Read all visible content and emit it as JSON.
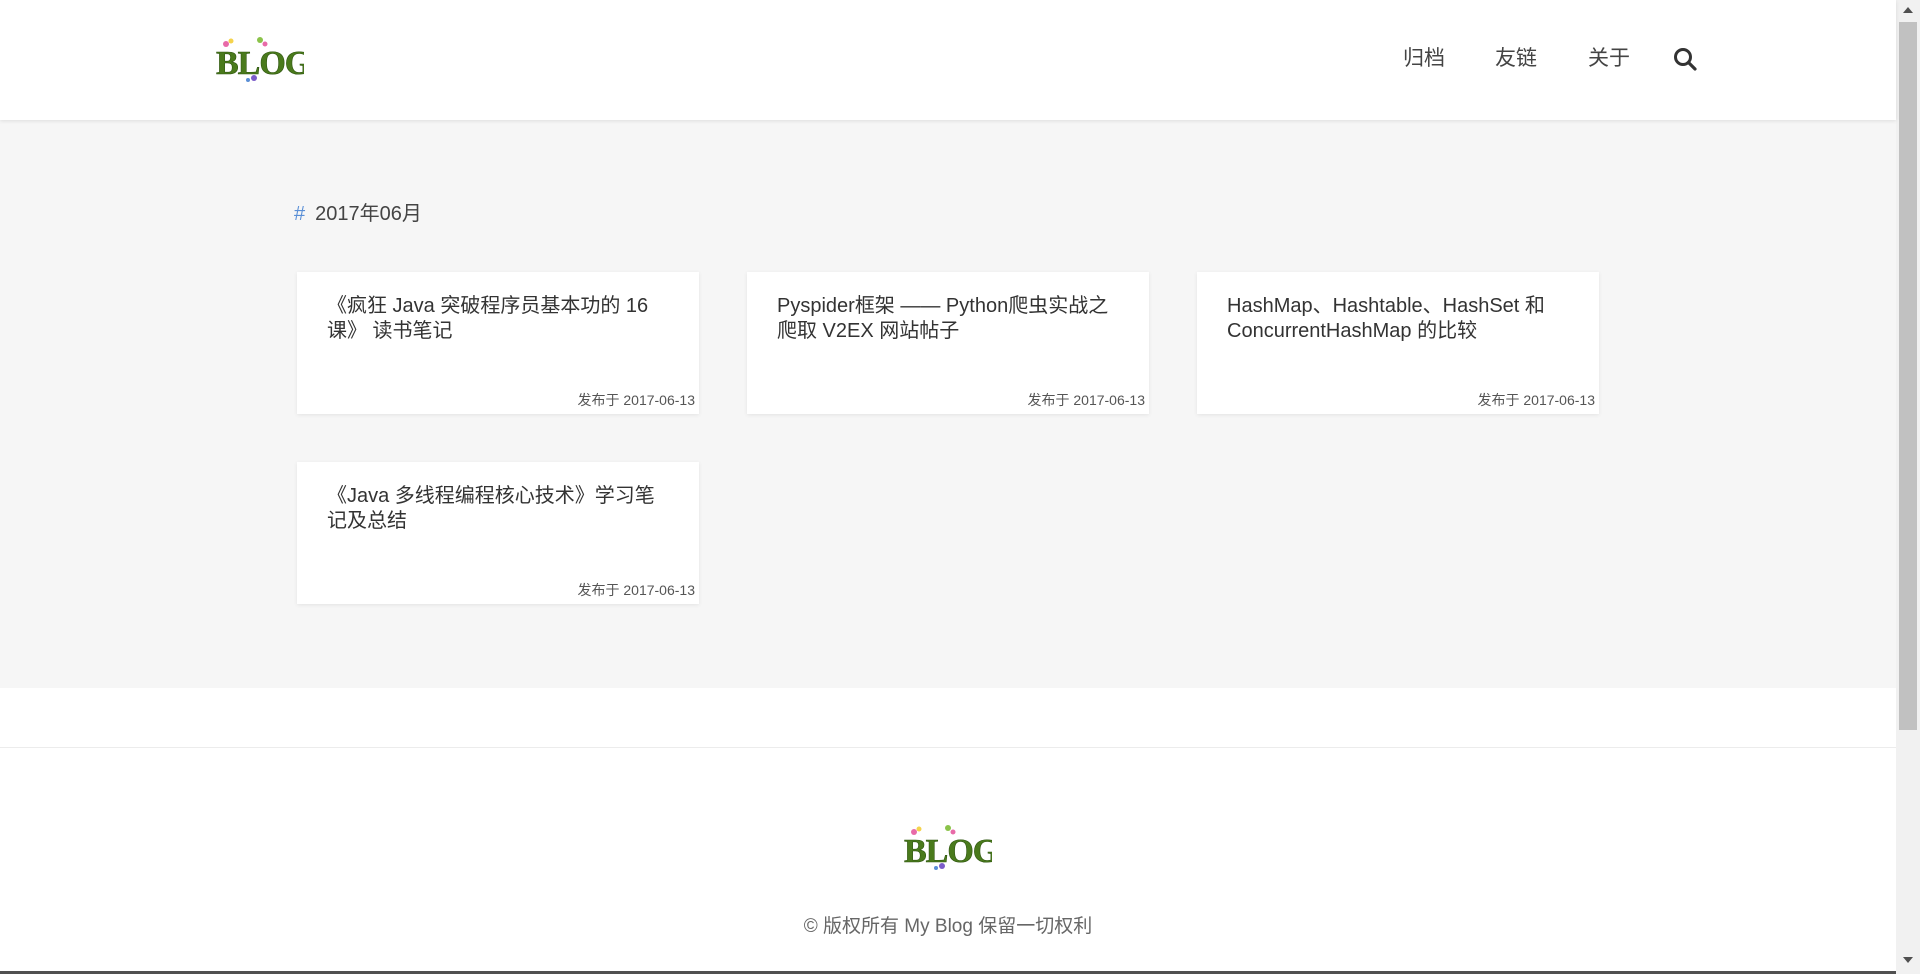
{
  "header": {
    "logo_text": "BLOG",
    "nav": [
      {
        "label": "归档"
      },
      {
        "label": "友链"
      },
      {
        "label": "关于"
      }
    ],
    "search_icon": "search-icon"
  },
  "archive": {
    "hash": "#",
    "month": "2017年06月",
    "posts": [
      {
        "title": "《疯狂 Java 突破程序员基本功的 16 课》 读书笔记",
        "date": "发布于 2017-06-13"
      },
      {
        "title": "Pyspider框架 —— Python爬虫实战之爬取 V2EX 网站帖子",
        "date": "发布于 2017-06-13"
      },
      {
        "title": "HashMap、Hashtable、HashSet 和 ConcurrentHashMap 的比较",
        "date": "发布于 2017-06-13"
      },
      {
        "title": "《Java 多线程编程核心技术》学习笔记及总结",
        "date": "发布于 2017-06-13"
      }
    ]
  },
  "footer": {
    "logo_text": "BLOG",
    "copyright": "© 版权所有 My Blog 保留一切权利"
  },
  "colors": {
    "accent_hash": "#5a8fd6",
    "background_gray": "#f6f6f6"
  }
}
